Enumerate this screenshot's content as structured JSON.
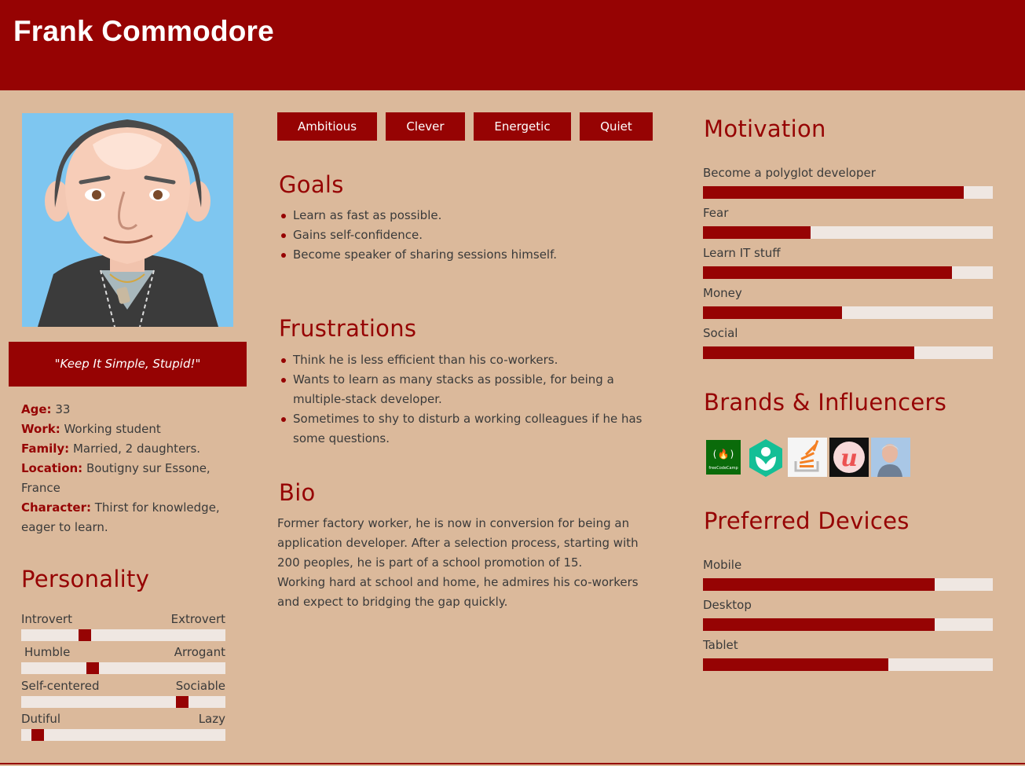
{
  "header": {
    "name": "Frank Commodore"
  },
  "profile": {
    "quote": "\"Keep It Simple, Stupid!\"",
    "age_label": "Age:",
    "age": "33",
    "work_label": "Work:",
    "work": "Working student",
    "family_label": "Family:",
    "family": "Married, 2 daughters.",
    "location_label": "Location:",
    "location": "Boutigny sur Essone, France",
    "character_label": "Character:",
    "character": "Thirst for knowledge, eager to learn."
  },
  "personality": {
    "title": "Personality",
    "traits": [
      {
        "left": "Introvert",
        "right": "Extrovert",
        "level": 0.31
      },
      {
        "left": "Humble",
        "right": "Arrogant",
        "level": 0.35
      },
      {
        "left": "Self-centered",
        "right": "Sociable",
        "level": 0.79
      },
      {
        "left": "Dutiful",
        "right": "Lazy",
        "level": 0.08
      }
    ]
  },
  "tags": [
    "Ambitious",
    "Clever",
    "Energetic",
    "Quiet"
  ],
  "goals": {
    "title": "Goals",
    "items": [
      "Learn as fast as possible.",
      "Gains self-confidence.",
      "Become speaker of sharing sessions himself."
    ]
  },
  "frustrations": {
    "title": "Frustrations",
    "items": [
      "Think he is less efficient than his co-workers.",
      "Wants to learn as many stacks as possible, for being a multiple-stack developer.",
      "Sometimes to shy to disturb a working colleagues if he has some questions."
    ]
  },
  "bio": {
    "title": "Bio",
    "paragraph1": "Former factory worker, he is now in conversion for being an application developer. After a selection process, starting with 200 peoples, he is part of a school promotion of 15.",
    "paragraph2": "Working hard at school and home, he admires his co-workers and expect to bridging the gap quickly."
  },
  "motivation": {
    "title": "Motivation",
    "items": [
      {
        "label": "Become a polyglot developer",
        "value": 0.9
      },
      {
        "label": "Fear",
        "value": 0.37
      },
      {
        "label": "Learn IT stuff",
        "value": 0.86
      },
      {
        "label": "Money",
        "value": 0.48
      },
      {
        "label": "Social",
        "value": 0.73
      }
    ]
  },
  "brands": {
    "title": "Brands & Influencers",
    "logos": [
      "freecodecamp-logo",
      "khan-academy-logo",
      "stack-overflow-logo",
      "udemy-logo",
      "influencer-photo"
    ],
    "freecodecamp_text": "freeCodeCamp",
    "udemy_text": "u"
  },
  "devices": {
    "title": "Preferred Devices",
    "items": [
      {
        "label": "Mobile",
        "value": 0.8
      },
      {
        "label": "Desktop",
        "value": 0.8
      },
      {
        "label": "Tablet",
        "value": 0.64
      }
    ]
  },
  "colors": {
    "accent": "#960303",
    "background": "#dbb99b",
    "track": "#efe7e2"
  }
}
